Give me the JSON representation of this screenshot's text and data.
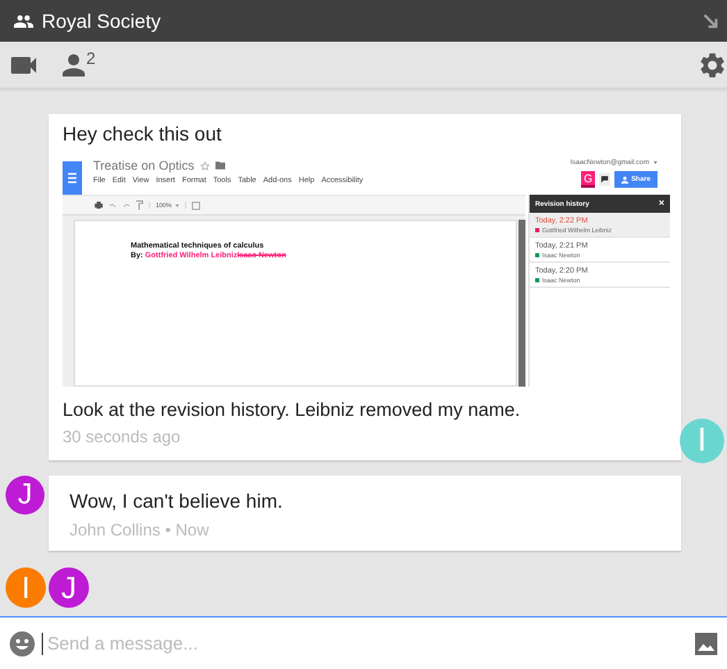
{
  "header": {
    "title": "Royal Society"
  },
  "toolbar": {
    "participant_count": "2"
  },
  "messages": [
    {
      "kind": "outgoing",
      "text": "Hey check this out",
      "attachment": {
        "title": "Treatise on Optics",
        "menu": [
          "File",
          "Edit",
          "View",
          "Insert",
          "Format",
          "Tools",
          "Table",
          "Add-ons",
          "Help",
          "Accessibility"
        ],
        "account": "IsaacNewton@gmail.com",
        "account_badge": "G",
        "share": "Share",
        "zoom": "100%",
        "heading": "Mathematical techniques of calculus",
        "byline_label": "By:",
        "byline": [
          {
            "text": "Gottfried Wilhelm Leibniz",
            "struck": false
          },
          {
            "text": "Isaac Newton",
            "struck": true
          }
        ],
        "revision_panel": {
          "title": "Revision history",
          "close": "×",
          "revisions": [
            {
              "time": "Today, 2:22 PM",
              "author": "Gottfried Wilhelm Leibniz",
              "color": "#e91e63",
              "selected": true
            },
            {
              "time": "Today, 2:21 PM",
              "author": "Isaac Newton",
              "color": "#0f9d58",
              "selected": false
            },
            {
              "time": "Today, 2:20 PM",
              "author": "Isaac Newton",
              "color": "#0f9d58",
              "selected": false
            }
          ]
        }
      },
      "caption": "Look at the revision history. Leibniz removed my name.",
      "meta": "30 seconds ago",
      "avatar": {
        "letter": "I",
        "color": "#6ad6d0"
      }
    },
    {
      "kind": "incoming",
      "text": "Wow, I can't believe him.",
      "meta": "John Collins • Now",
      "avatar": {
        "letter": "J",
        "color": "#bd1bd4"
      }
    }
  ],
  "typing": [
    {
      "letter": "I",
      "color": "#fb7c00"
    },
    {
      "letter": "J",
      "color": "#bd1bd4"
    }
  ],
  "composer": {
    "placeholder": "Send a message..."
  }
}
